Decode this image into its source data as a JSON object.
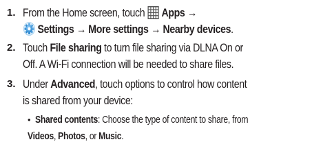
{
  "steps": [
    {
      "number": "1.",
      "line1": {
        "pre": "From the Home screen, touch ",
        "icon": "apps-grid-icon",
        "apps": "Apps",
        "arrow": " →"
      },
      "line2": {
        "icon": "settings-gear-icon",
        "settings": "Settings",
        "a1": " → ",
        "more": "More settings",
        "a2": " → ",
        "nearby": "Nearby devices",
        "end": "."
      }
    },
    {
      "number": "2.",
      "line1": {
        "pre": "Touch ",
        "bold": "File sharing",
        "post": " to turn file sharing via DLNA On or"
      },
      "line2": "Off. A Wi-Fi connection will be needed to share files."
    },
    {
      "number": "3.",
      "line1": {
        "pre": "Under ",
        "bold": "Advanced",
        "post": ", touch options to control how content"
      },
      "line2": "is shared from your device:",
      "bullet": {
        "marker": "•",
        "line1": {
          "bold": "Shared contents",
          "post": ": Choose the type of content to share, from"
        },
        "line2": {
          "videos": "Videos",
          "c1": ", ",
          "photos": "Photos",
          "c2": ", or ",
          "music": "Music",
          "end": "."
        }
      }
    }
  ],
  "colors": {
    "text": "#231f20",
    "icon_grid": "#555555",
    "icon_gear": "#2a8fd6"
  }
}
